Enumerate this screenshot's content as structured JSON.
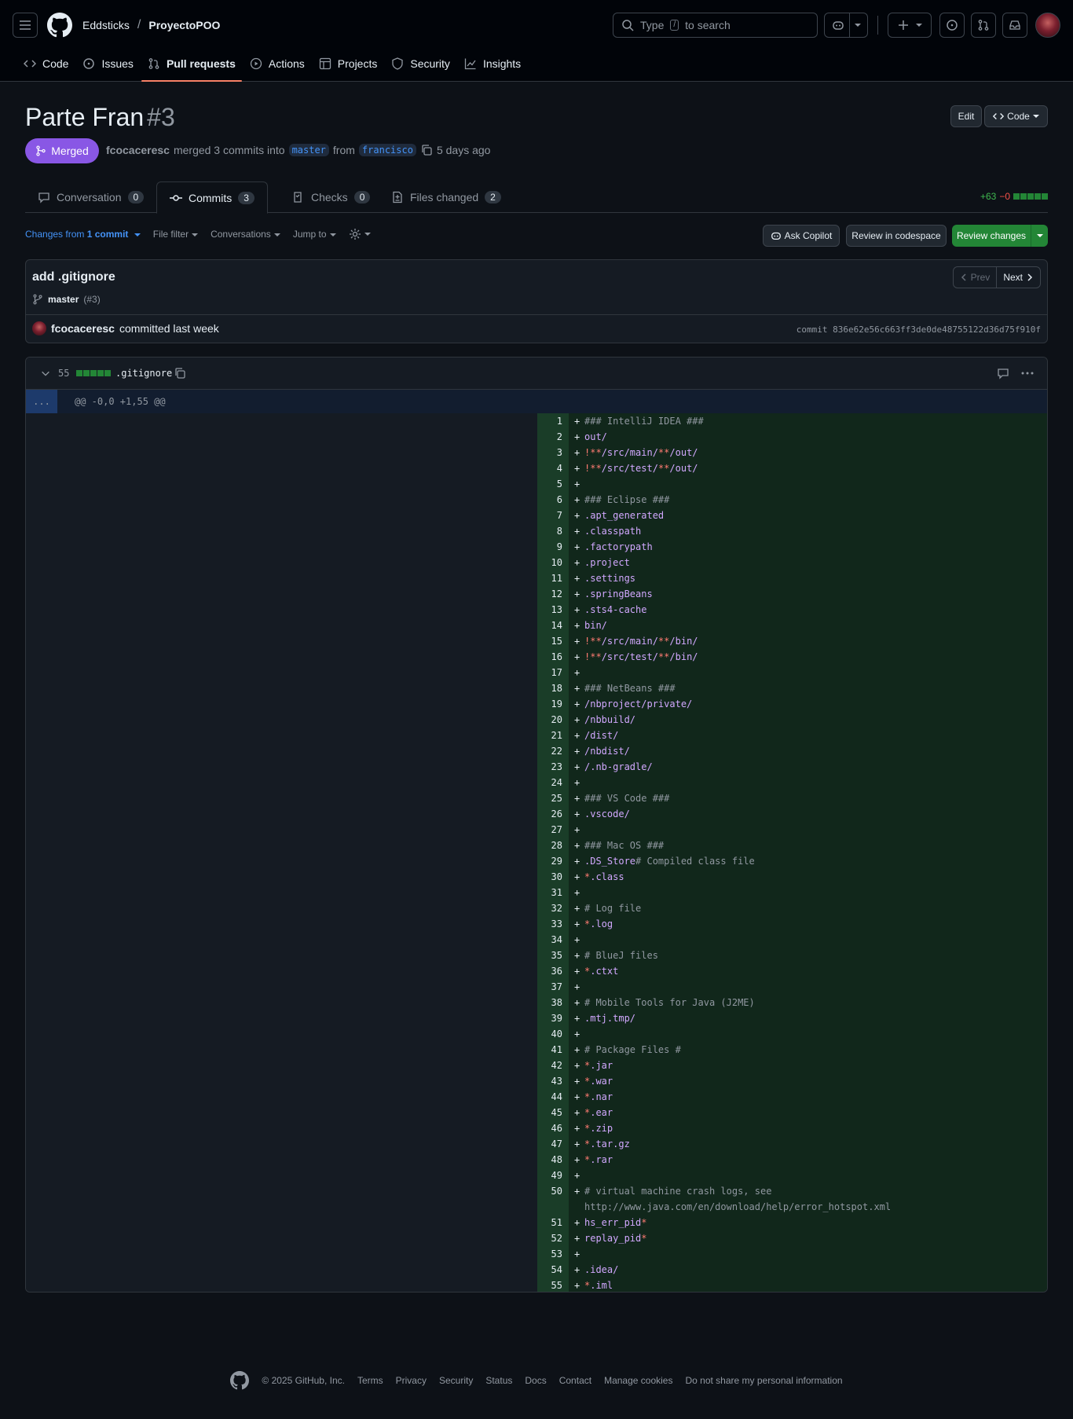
{
  "header": {
    "owner": "Eddsticks",
    "separator": "/",
    "repo": "ProyectoPOO",
    "search_prefix": "Type",
    "search_key": "/",
    "search_suffix": "to search"
  },
  "repo_nav": [
    {
      "label": "Code",
      "icon": "code-icon"
    },
    {
      "label": "Issues",
      "icon": "issue-icon"
    },
    {
      "label": "Pull requests",
      "icon": "pull-request-icon",
      "active": true
    },
    {
      "label": "Actions",
      "icon": "play-icon"
    },
    {
      "label": "Projects",
      "icon": "table-icon"
    },
    {
      "label": "Security",
      "icon": "shield-icon"
    },
    {
      "label": "Insights",
      "icon": "graph-icon"
    }
  ],
  "pr": {
    "title": "Parte Fran",
    "number": "#3",
    "status": "Merged",
    "author": "fcocaceresc",
    "merged_text": "merged 3 commits into",
    "base": "master",
    "from_text": "from",
    "head": "francisco",
    "when": "5 days ago",
    "edit_label": "Edit",
    "code_label": "Code"
  },
  "tabs": [
    {
      "label": "Conversation",
      "count": "0",
      "icon": "comment-icon"
    },
    {
      "label": "Commits",
      "count": "3",
      "icon": "commit-icon"
    },
    {
      "label": "Checks",
      "count": "0",
      "icon": "checklist-icon"
    },
    {
      "label": "Files changed",
      "count": "2",
      "icon": "file-diff-icon"
    }
  ],
  "diffstat": {
    "added": "+63",
    "removed": "−0"
  },
  "toolbar": {
    "changes_prefix": "Changes from",
    "changes_link": "1 commit",
    "file_filter": "File filter",
    "conversations": "Conversations",
    "jump_to": "Jump to",
    "ask_copilot": "Ask Copilot",
    "review_codespace": "Review in codespace",
    "review_changes": "Review changes"
  },
  "commit": {
    "title": "add .gitignore",
    "branch": "master",
    "pr_ref": "(#3)",
    "author": "fcocaceresc",
    "committed": "committed last week",
    "sha": "commit 836e62e56c663ff3de0de48755122d36d75f910f",
    "prev": "Prev",
    "next": "Next"
  },
  "file": {
    "changes": "55",
    "name": ".gitignore",
    "hunk_expand": "...",
    "hunk": "@@ -0,0 +1,55 @@"
  },
  "diff_lines": [
    {
      "n": "1",
      "text": "### IntelliJ IDEA ###"
    },
    {
      "n": "2",
      "text": "out/"
    },
    {
      "n": "3",
      "text": "!**/src/main/**/out/"
    },
    {
      "n": "4",
      "text": "!**/src/test/**/out/"
    },
    {
      "n": "5",
      "text": ""
    },
    {
      "n": "6",
      "text": "### Eclipse ###"
    },
    {
      "n": "7",
      "text": ".apt_generated"
    },
    {
      "n": "8",
      "text": ".classpath"
    },
    {
      "n": "9",
      "text": ".factorypath"
    },
    {
      "n": "10",
      "text": ".project"
    },
    {
      "n": "11",
      "text": ".settings"
    },
    {
      "n": "12",
      "text": ".springBeans"
    },
    {
      "n": "13",
      "text": ".sts4-cache"
    },
    {
      "n": "14",
      "text": "bin/"
    },
    {
      "n": "15",
      "text": "!**/src/main/**/bin/"
    },
    {
      "n": "16",
      "text": "!**/src/test/**/bin/"
    },
    {
      "n": "17",
      "text": ""
    },
    {
      "n": "18",
      "text": "### NetBeans ###"
    },
    {
      "n": "19",
      "text": "/nbproject/private/"
    },
    {
      "n": "20",
      "text": "/nbbuild/"
    },
    {
      "n": "21",
      "text": "/dist/"
    },
    {
      "n": "22",
      "text": "/nbdist/"
    },
    {
      "n": "23",
      "text": "/.nb-gradle/"
    },
    {
      "n": "24",
      "text": ""
    },
    {
      "n": "25",
      "text": "### VS Code ###"
    },
    {
      "n": "26",
      "text": ".vscode/"
    },
    {
      "n": "27",
      "text": ""
    },
    {
      "n": "28",
      "text": "### Mac OS ###"
    },
    {
      "n": "29",
      "text": ".DS_Store# Compiled class file"
    },
    {
      "n": "30",
      "text": "*.class"
    },
    {
      "n": "31",
      "text": ""
    },
    {
      "n": "32",
      "text": "# Log file"
    },
    {
      "n": "33",
      "text": "*.log"
    },
    {
      "n": "34",
      "text": ""
    },
    {
      "n": "35",
      "text": "# BlueJ files"
    },
    {
      "n": "36",
      "text": "*.ctxt"
    },
    {
      "n": "37",
      "text": ""
    },
    {
      "n": "38",
      "text": "# Mobile Tools for Java (J2ME)"
    },
    {
      "n": "39",
      "text": ".mtj.tmp/"
    },
    {
      "n": "40",
      "text": ""
    },
    {
      "n": "41",
      "text": "# Package Files #"
    },
    {
      "n": "42",
      "text": "*.jar"
    },
    {
      "n": "43",
      "text": "*.war"
    },
    {
      "n": "44",
      "text": "*.nar"
    },
    {
      "n": "45",
      "text": "*.ear"
    },
    {
      "n": "46",
      "text": "*.zip"
    },
    {
      "n": "47",
      "text": "*.tar.gz"
    },
    {
      "n": "48",
      "text": "*.rar"
    },
    {
      "n": "49",
      "text": ""
    },
    {
      "n": "50",
      "text": "# virtual machine crash logs, see http://www.java.com/en/download/help/error_hotspot.xml"
    },
    {
      "n": "51",
      "text": "hs_err_pid*"
    },
    {
      "n": "52",
      "text": "replay_pid*"
    },
    {
      "n": "53",
      "text": ""
    },
    {
      "n": "54",
      "text": ".idea/"
    },
    {
      "n": "55",
      "text": "*.iml"
    }
  ],
  "footer": {
    "copyright": "© 2025 GitHub, Inc.",
    "links": [
      "Terms",
      "Privacy",
      "Security",
      "Status",
      "Docs",
      "Contact",
      "Manage cookies",
      "Do not share my personal information"
    ]
  },
  "colors": {
    "background": "#0d1117",
    "merged": "#8957e5",
    "added_bg": "#11271b",
    "accent": "#4493f8",
    "tab_underline": "#f78166"
  }
}
